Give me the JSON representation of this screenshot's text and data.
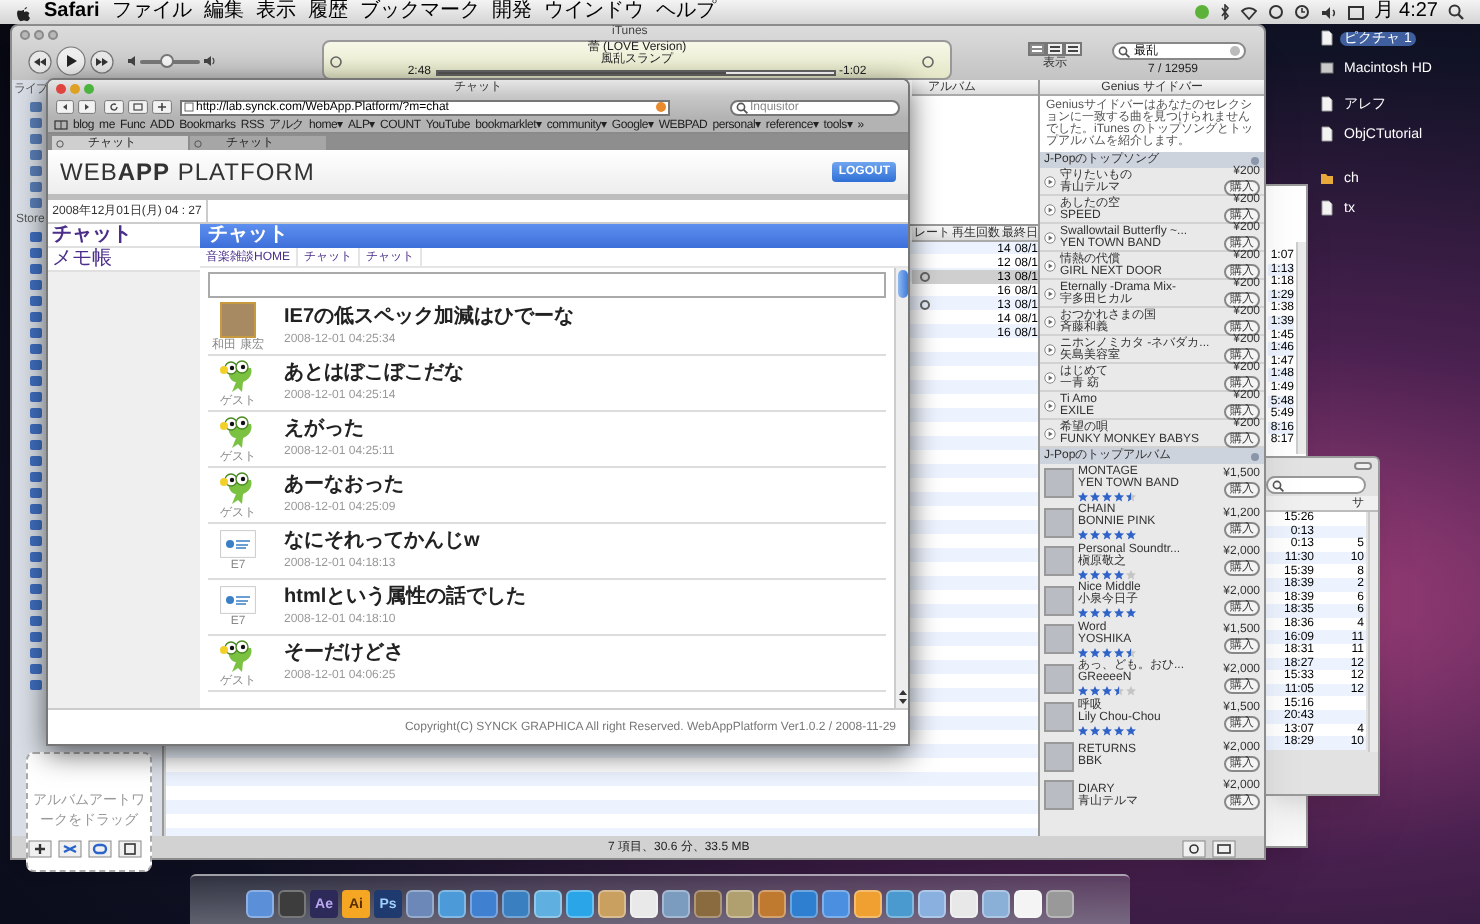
{
  "menu_bar": {
    "app_name": "Safari",
    "menus": [
      "ファイル",
      "編集",
      "表示",
      "履歴",
      "ブックマーク",
      "開発",
      "ウインドウ",
      "ヘルプ"
    ],
    "clock": "月 4:27"
  },
  "desktop_icons": [
    {
      "label": "ピクチャ 1",
      "selected": true
    },
    {
      "label": "Macintosh HD",
      "selected": false
    },
    {
      "label": "アレフ",
      "selected": false
    },
    {
      "label": "ObjCTutorial",
      "selected": false
    },
    {
      "label": "ch",
      "selected": false
    },
    {
      "label": "tx",
      "selected": false
    }
  ],
  "itunes": {
    "title": "iTunes",
    "sidebar_header": "ライブ",
    "store_header": "Store",
    "now_playing": {
      "title": "蕾 (LOVE Version)",
      "artist": "風乱スランプ",
      "elapsed": "2:48",
      "remaining": "-1:02",
      "level": 0.73
    },
    "volume": {
      "level": 0.45
    },
    "view_buttons": [
      {
        "selected": true
      },
      {
        "selected": false
      },
      {
        "selected": false
      }
    ],
    "view_label": "表示",
    "search": {
      "value": "最乱"
    },
    "result_count": "7 / 12959",
    "browser_column": "アルバム",
    "list_columns": [
      "レート",
      "再生回数",
      "最終日"
    ],
    "rows": [
      {
        "plays": "14",
        "date": "08/1",
        "selected": false
      },
      {
        "plays": "12",
        "date": "08/1",
        "selected": false
      },
      {
        "plays": "13",
        "date": "08/1",
        "selected": true
      },
      {
        "plays": "16",
        "date": "08/1",
        "selected": false
      },
      {
        "plays": "13",
        "date": "08/1",
        "selected": false
      },
      {
        "plays": "14",
        "date": "08/1",
        "selected": false
      },
      {
        "plays": "16",
        "date": "08/1",
        "selected": false
      }
    ],
    "artwork_hint": "アルバムアートワークをドラッグ",
    "status": "7 項目、30.6 分、33.5 MB",
    "genius": {
      "title": "Genius サイドバー",
      "message": "Geniusサイドバーはあなたのセレクションに一致する曲を見つけられませんでした。iTunes のトップソングとトップアルバムを紹介します。",
      "songs_header": "J-Popのトップソング",
      "songs": [
        {
          "title": "守りたいもの",
          "artist": "青山テルマ",
          "price": "¥200",
          "buy": "購入"
        },
        {
          "title": "あしたの空",
          "artist": "SPEED",
          "price": "¥200",
          "buy": "購入"
        },
        {
          "title": "Swallowtail Butterfly ~...",
          "artist": "YEN TOWN BAND",
          "price": "¥200",
          "buy": "購入"
        },
        {
          "title": "情熱の代償",
          "artist": "GIRL NEXT DOOR",
          "price": "¥200",
          "buy": "購入"
        },
        {
          "title": "Eternally -Drama Mix-",
          "artist": "宇多田ヒカル",
          "price": "¥200",
          "buy": "購入"
        },
        {
          "title": "おつかれさまの国",
          "artist": "斉藤和義",
          "price": "¥200",
          "buy": "購入"
        },
        {
          "title": "ニホンノミカタ -ネバダカ...",
          "artist": "矢島美容室",
          "price": "¥200",
          "buy": "購入"
        },
        {
          "title": "はじめて",
          "artist": "一青 窈",
          "price": "¥200",
          "buy": "購入"
        },
        {
          "title": "Ti Amo",
          "artist": "EXILE",
          "price": "¥200",
          "buy": "購入"
        },
        {
          "title": "希望の唄",
          "artist": "FUNKY MONKEY BABYS",
          "price": "¥200",
          "buy": "購入"
        }
      ],
      "albums_header": "J-Popのトップアルバム",
      "albums": [
        {
          "title": "MONTAGE",
          "artist": "YEN TOWN BAND",
          "stars": 4.5,
          "price": "¥1,500",
          "buy": "購入"
        },
        {
          "title": "CHAIN",
          "artist": "BONNIE PINK",
          "stars": 5,
          "price": "¥1,200",
          "buy": "購入"
        },
        {
          "title": "Personal Soundtr...",
          "artist": "槇原敬之",
          "stars": 4,
          "price": "¥2,000",
          "buy": "購入"
        },
        {
          "title": "Nice Middle",
          "artist": "小泉今日子",
          "stars": 5,
          "price": "¥2,000",
          "buy": "購入"
        },
        {
          "title": "Word",
          "artist": "YOSHIKA",
          "stars": 4.5,
          "price": "¥1,500",
          "buy": "購入"
        },
        {
          "title": "あっ、ども。おひ...",
          "artist": "GReeeeN",
          "stars": 3.5,
          "price": "¥2,000",
          "buy": "購入"
        },
        {
          "title": "呼吸",
          "artist": "Lily Chou-Chou",
          "stars": 5,
          "price": "¥1,500",
          "buy": "購入"
        },
        {
          "title": "RETURNS",
          "artist": "BBK",
          "price": "¥2,000",
          "buy": "購入"
        },
        {
          "title": "DIARY",
          "artist": "青山テルマ",
          "price": "¥2,000",
          "buy": "購入"
        }
      ]
    }
  },
  "finder_back": {
    "times": [
      "1:07",
      "1:13",
      "1:18",
      "1:29",
      "1:38",
      "1:39",
      "1:45",
      "1:46",
      "1:47",
      "1:48",
      "1:49",
      "5:48",
      "5:49",
      "8:16",
      "8:17"
    ]
  },
  "finder_front": {
    "column_2": "サ",
    "rows": [
      {
        "time": "15:26",
        "size": ""
      },
      {
        "time": "0:13",
        "size": ""
      },
      {
        "time": "0:13",
        "size": "5"
      },
      {
        "time": "11:30",
        "size": "10"
      },
      {
        "time": "15:39",
        "size": "8"
      },
      {
        "time": "18:39",
        "size": "2"
      },
      {
        "time": "18:39",
        "size": "6"
      },
      {
        "time": "18:35",
        "size": "6"
      },
      {
        "time": "18:36",
        "size": "4"
      },
      {
        "time": "16:09",
        "size": "11"
      },
      {
        "time": "18:31",
        "size": "11"
      },
      {
        "time": "18:27",
        "size": "12"
      },
      {
        "time": "15:33",
        "size": "12"
      },
      {
        "time": "11:05",
        "size": "12"
      },
      {
        "time": "15:16",
        "size": ""
      },
      {
        "time": "20:43",
        "size": ""
      },
      {
        "time": "13:07",
        "size": "4"
      },
      {
        "time": "18:29",
        "size": "10"
      }
    ]
  },
  "safari": {
    "title": "チャット",
    "url": "http://lab.synck.com/WebApp.Platform/?m=chat",
    "search_placeholder": "Inquisitor",
    "bookmarks": [
      "blog",
      "me",
      "Func",
      "ADD",
      "Bookmarks",
      "RSS",
      "アルク",
      "home▾",
      "ALP▾",
      "COUNT",
      "YouTube",
      "bookmarklet▾",
      "community▾",
      "Google▾",
      "WEBPAD",
      "personal▾",
      "reference▾",
      "tools▾",
      "»"
    ],
    "tabs": [
      {
        "label": "チャット",
        "selected": true
      },
      {
        "label": "チャット",
        "selected": false
      }
    ],
    "page": {
      "logo": "WEB**APP** PLATFORM",
      "logout": "LOGOUT",
      "date": "2008年12月01日(月) 04 : 27",
      "nav": [
        {
          "label": "チャット",
          "selected": true
        },
        {
          "label": "メモ帳",
          "selected": false
        }
      ],
      "panel_title": "チャット",
      "breadcrumbs": [
        "音楽雑談HOME",
        "チャット",
        "チャット"
      ],
      "messages": [
        {
          "kind": "photo",
          "user": "和田 康宏",
          "text": "IE7の低スペック加減はひでーな",
          "time": "2008-12-01 04:25:34"
        },
        {
          "kind": "frog",
          "user": "ゲスト",
          "text": "あとはぼこぼこだな",
          "time": "2008-12-01 04:25:14"
        },
        {
          "kind": "frog",
          "user": "ゲスト",
          "text": "えがった",
          "time": "2008-12-01 04:25:11"
        },
        {
          "kind": "frog",
          "user": "ゲスト",
          "text": "あーなおった",
          "time": "2008-12-01 04:25:09"
        },
        {
          "kind": "logo",
          "user": "E7",
          "text": "なにそれってかんじw",
          "time": "2008-12-01 04:18:13"
        },
        {
          "kind": "logo",
          "user": "E7",
          "text": "htmlという属性の話でした",
          "time": "2008-12-01 04:18:10"
        },
        {
          "kind": "frog",
          "user": "ゲスト",
          "text": "そーだけどさ",
          "time": "2008-12-01 04:06:25"
        }
      ],
      "footer": "Copyright(C) SYNCK GRAPHICA All right Reserved. WebAppPlatform Ver1.0.2 / 2008-11-29"
    }
  },
  "dock": {
    "labels": [
      "Ae",
      "Ai",
      "Ps"
    ]
  }
}
